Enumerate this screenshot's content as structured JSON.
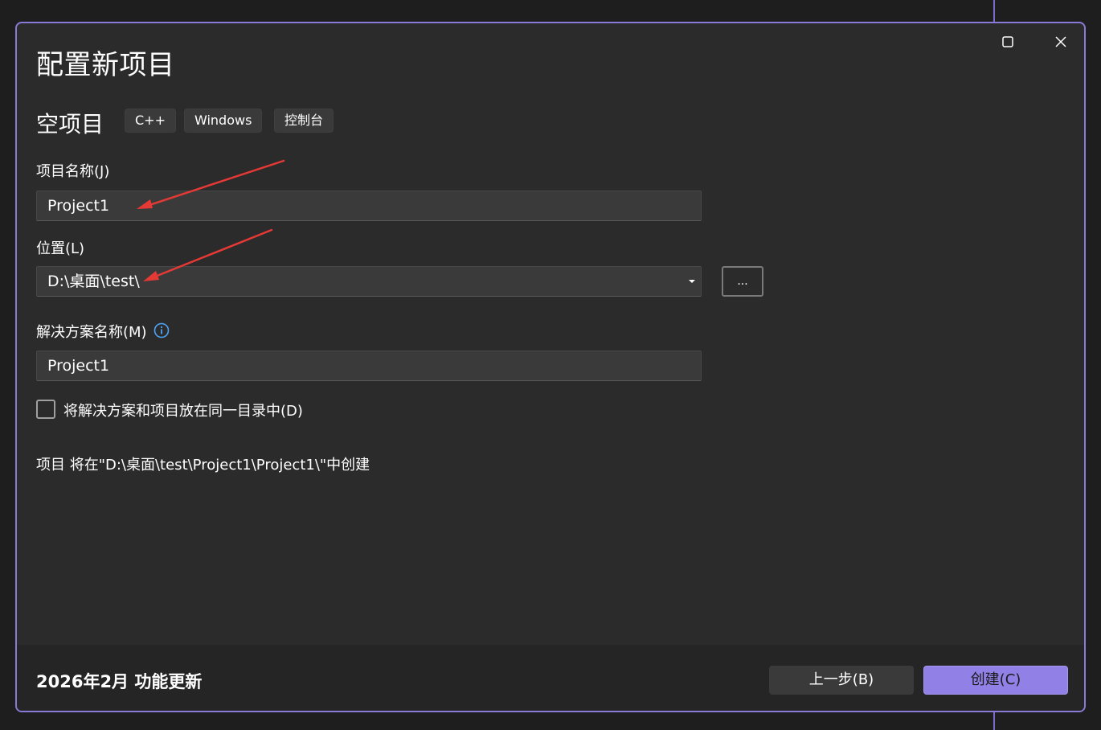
{
  "dialog": {
    "title": "配置新项目",
    "template_name": "空项目",
    "tags": [
      "C++",
      "Windows",
      "控制台"
    ]
  },
  "fields": {
    "project_name_label": "项目名称(J)",
    "project_name_value": "Project1",
    "location_label": "位置(L)",
    "location_value": "D:\\桌面\\test\\",
    "browse_label": "...",
    "solution_name_label": "解决方案名称(M)",
    "solution_name_value": "Project1"
  },
  "checkbox": {
    "label": "将解决方案和项目放在同一目录中(D)",
    "checked": false
  },
  "path_info": "项目 将在\"D:\\桌面\\test\\Project1\\Project1\\\"中创建",
  "footer": {
    "release_note": "2026年2月 功能更新",
    "back_label": "上一步(B)",
    "create_label": "创建(C)"
  },
  "colors": {
    "accent": "#9181e6",
    "border": "#8a7ad8",
    "annotation_arrow": "#e53935",
    "info_icon": "#4fa3f7"
  }
}
